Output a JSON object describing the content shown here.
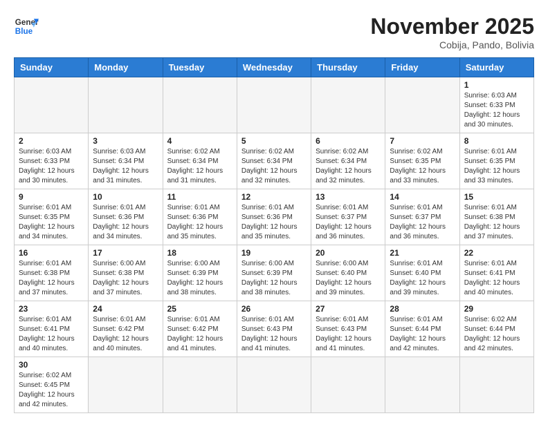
{
  "logo": {
    "line1": "General",
    "line2": "Blue"
  },
  "title": "November 2025",
  "subtitle": "Cobija, Pando, Bolivia",
  "weekdays": [
    "Sunday",
    "Monday",
    "Tuesday",
    "Wednesday",
    "Thursday",
    "Friday",
    "Saturday"
  ],
  "weeks": [
    [
      {
        "day": null,
        "info": null
      },
      {
        "day": null,
        "info": null
      },
      {
        "day": null,
        "info": null
      },
      {
        "day": null,
        "info": null
      },
      {
        "day": null,
        "info": null
      },
      {
        "day": null,
        "info": null
      },
      {
        "day": "1",
        "info": "Sunrise: 6:03 AM\nSunset: 6:33 PM\nDaylight: 12 hours and 30 minutes."
      }
    ],
    [
      {
        "day": "2",
        "info": "Sunrise: 6:03 AM\nSunset: 6:33 PM\nDaylight: 12 hours and 30 minutes."
      },
      {
        "day": "3",
        "info": "Sunrise: 6:03 AM\nSunset: 6:34 PM\nDaylight: 12 hours and 31 minutes."
      },
      {
        "day": "4",
        "info": "Sunrise: 6:02 AM\nSunset: 6:34 PM\nDaylight: 12 hours and 31 minutes."
      },
      {
        "day": "5",
        "info": "Sunrise: 6:02 AM\nSunset: 6:34 PM\nDaylight: 12 hours and 32 minutes."
      },
      {
        "day": "6",
        "info": "Sunrise: 6:02 AM\nSunset: 6:34 PM\nDaylight: 12 hours and 32 minutes."
      },
      {
        "day": "7",
        "info": "Sunrise: 6:02 AM\nSunset: 6:35 PM\nDaylight: 12 hours and 33 minutes."
      },
      {
        "day": "8",
        "info": "Sunrise: 6:01 AM\nSunset: 6:35 PM\nDaylight: 12 hours and 33 minutes."
      }
    ],
    [
      {
        "day": "9",
        "info": "Sunrise: 6:01 AM\nSunset: 6:35 PM\nDaylight: 12 hours and 34 minutes."
      },
      {
        "day": "10",
        "info": "Sunrise: 6:01 AM\nSunset: 6:36 PM\nDaylight: 12 hours and 34 minutes."
      },
      {
        "day": "11",
        "info": "Sunrise: 6:01 AM\nSunset: 6:36 PM\nDaylight: 12 hours and 35 minutes."
      },
      {
        "day": "12",
        "info": "Sunrise: 6:01 AM\nSunset: 6:36 PM\nDaylight: 12 hours and 35 minutes."
      },
      {
        "day": "13",
        "info": "Sunrise: 6:01 AM\nSunset: 6:37 PM\nDaylight: 12 hours and 36 minutes."
      },
      {
        "day": "14",
        "info": "Sunrise: 6:01 AM\nSunset: 6:37 PM\nDaylight: 12 hours and 36 minutes."
      },
      {
        "day": "15",
        "info": "Sunrise: 6:01 AM\nSunset: 6:38 PM\nDaylight: 12 hours and 37 minutes."
      }
    ],
    [
      {
        "day": "16",
        "info": "Sunrise: 6:01 AM\nSunset: 6:38 PM\nDaylight: 12 hours and 37 minutes."
      },
      {
        "day": "17",
        "info": "Sunrise: 6:00 AM\nSunset: 6:38 PM\nDaylight: 12 hours and 37 minutes."
      },
      {
        "day": "18",
        "info": "Sunrise: 6:00 AM\nSunset: 6:39 PM\nDaylight: 12 hours and 38 minutes."
      },
      {
        "day": "19",
        "info": "Sunrise: 6:00 AM\nSunset: 6:39 PM\nDaylight: 12 hours and 38 minutes."
      },
      {
        "day": "20",
        "info": "Sunrise: 6:00 AM\nSunset: 6:40 PM\nDaylight: 12 hours and 39 minutes."
      },
      {
        "day": "21",
        "info": "Sunrise: 6:01 AM\nSunset: 6:40 PM\nDaylight: 12 hours and 39 minutes."
      },
      {
        "day": "22",
        "info": "Sunrise: 6:01 AM\nSunset: 6:41 PM\nDaylight: 12 hours and 40 minutes."
      }
    ],
    [
      {
        "day": "23",
        "info": "Sunrise: 6:01 AM\nSunset: 6:41 PM\nDaylight: 12 hours and 40 minutes."
      },
      {
        "day": "24",
        "info": "Sunrise: 6:01 AM\nSunset: 6:42 PM\nDaylight: 12 hours and 40 minutes."
      },
      {
        "day": "25",
        "info": "Sunrise: 6:01 AM\nSunset: 6:42 PM\nDaylight: 12 hours and 41 minutes."
      },
      {
        "day": "26",
        "info": "Sunrise: 6:01 AM\nSunset: 6:43 PM\nDaylight: 12 hours and 41 minutes."
      },
      {
        "day": "27",
        "info": "Sunrise: 6:01 AM\nSunset: 6:43 PM\nDaylight: 12 hours and 41 minutes."
      },
      {
        "day": "28",
        "info": "Sunrise: 6:01 AM\nSunset: 6:44 PM\nDaylight: 12 hours and 42 minutes."
      },
      {
        "day": "29",
        "info": "Sunrise: 6:02 AM\nSunset: 6:44 PM\nDaylight: 12 hours and 42 minutes."
      }
    ],
    [
      {
        "day": "30",
        "info": "Sunrise: 6:02 AM\nSunset: 6:45 PM\nDaylight: 12 hours and 42 minutes."
      },
      {
        "day": null,
        "info": null
      },
      {
        "day": null,
        "info": null
      },
      {
        "day": null,
        "info": null
      },
      {
        "day": null,
        "info": null
      },
      {
        "day": null,
        "info": null
      },
      {
        "day": null,
        "info": null
      }
    ]
  ]
}
